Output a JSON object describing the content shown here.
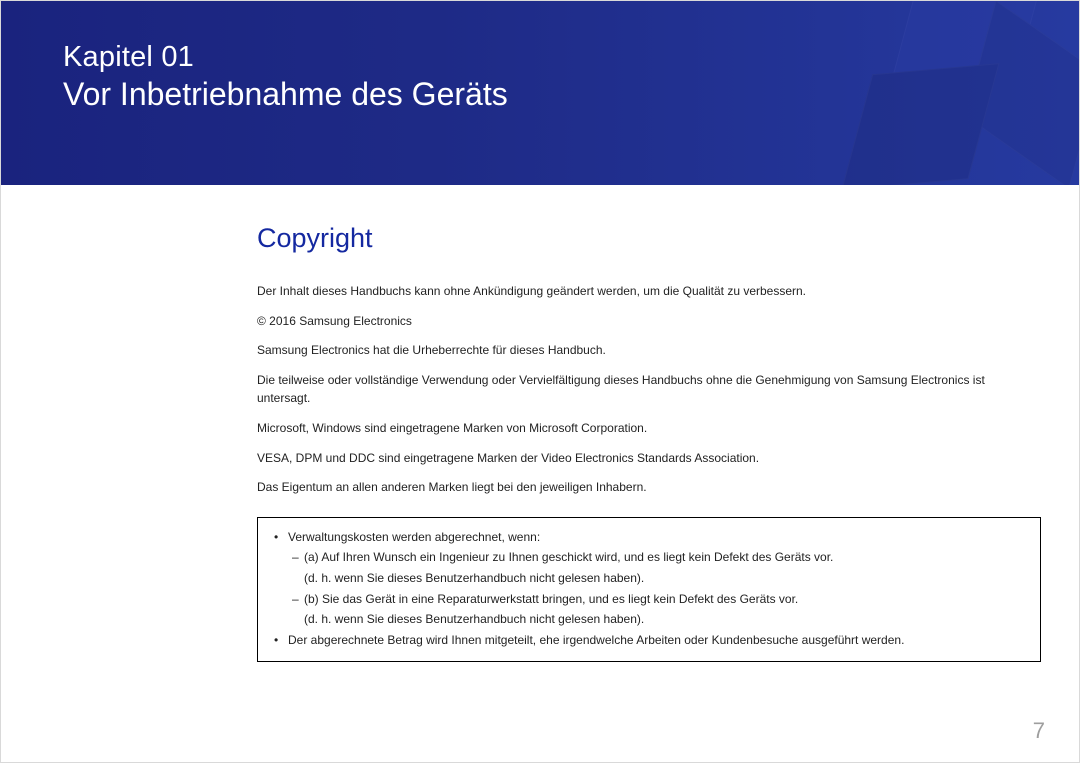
{
  "banner": {
    "chapter_label": "Kapitel 01",
    "chapter_title": "Vor Inbetriebnahme des Geräts"
  },
  "section": {
    "heading": "Copyright",
    "paragraphs": [
      "Der Inhalt dieses Handbuchs kann ohne Ankündigung geändert werden, um die Qualität zu verbessern.",
      "© 2016 Samsung Electronics",
      "Samsung Electronics hat die Urheberrechte für dieses Handbuch.",
      "Die teilweise oder vollständige Verwendung oder Vervielfältigung dieses Handbuchs ohne die Genehmigung von Samsung Electronics ist untersagt.",
      "Microsoft, Windows sind eingetragene Marken von Microsoft Corporation.",
      "VESA, DPM und DDC sind eingetragene Marken der Video Electronics Standards Association.",
      "Das Eigentum an allen anderen Marken liegt bei den jeweiligen Inhabern."
    ]
  },
  "notice": {
    "b1": "Verwaltungskosten werden abgerechnet, wenn:",
    "d1": "(a) Auf Ihren Wunsch ein Ingenieur zu Ihnen geschickt wird, und es liegt kein Defekt des Geräts vor.",
    "d1b": "(d. h. wenn Sie dieses Benutzerhandbuch nicht gelesen haben).",
    "d2": "(b) Sie das Gerät in eine Reparaturwerkstatt bringen, und es liegt kein Defekt des Geräts vor.",
    "d2b": "(d. h. wenn Sie dieses Benutzerhandbuch nicht gelesen haben).",
    "b2": "Der abgerechnete Betrag wird Ihnen mitgeteilt, ehe irgendwelche Arbeiten oder Kundenbesuche ausgeführt werden."
  },
  "page_number": "7"
}
